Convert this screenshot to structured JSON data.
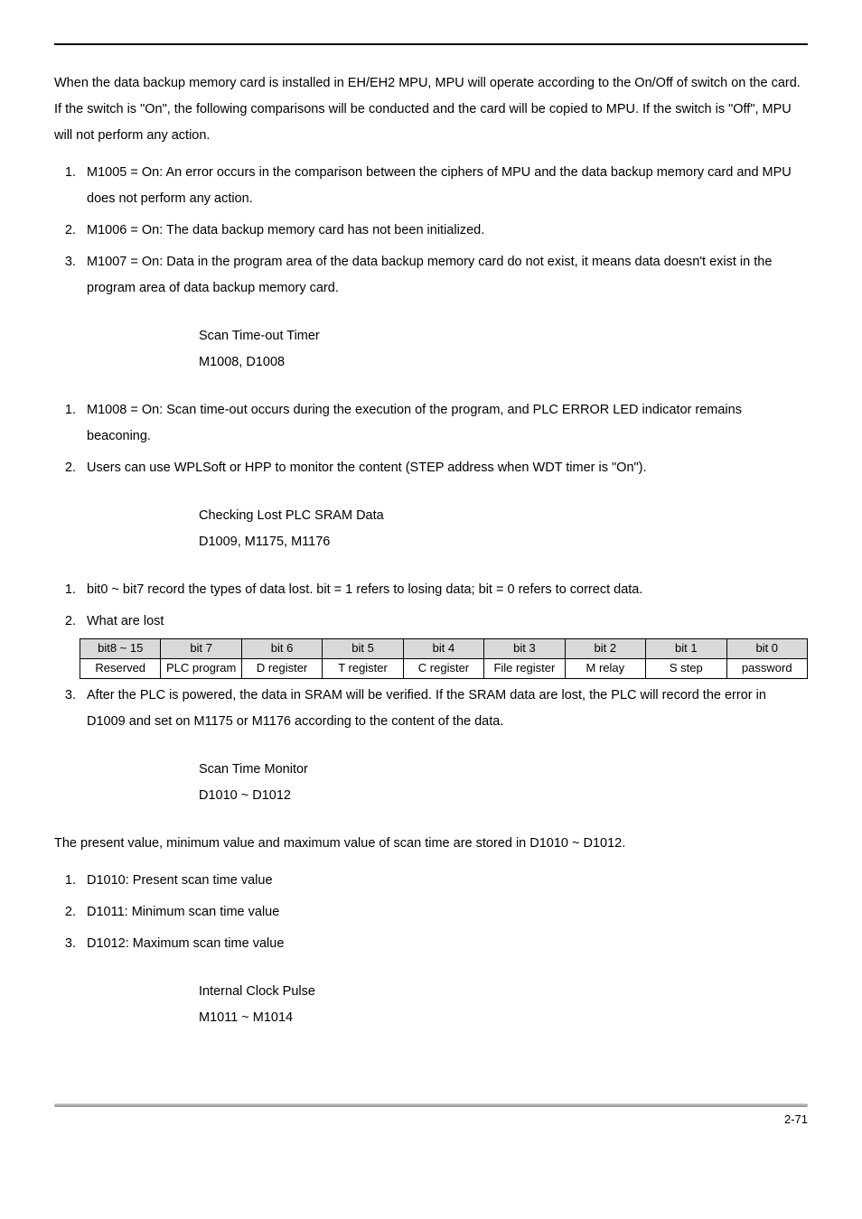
{
  "intro": "When the data backup memory card is installed in EH/EH2 MPU, MPU will operate according to the On/Off of switch on the card. If the switch is \"On\", the following comparisons will be conducted and the card will be copied to MPU. If the switch is \"Off\", MPU will not perform any action.",
  "introList": [
    "M1005 = On: An error occurs in the comparison between the ciphers of MPU and the data backup memory card and MPU does not perform any action.",
    "M1006 = On: The data backup memory card has not been initialized.",
    "M1007 = On: Data in the program area of the data backup memory card do not exist, it means data doesn't exist in the program area of data backup memory card."
  ],
  "sec1": {
    "title": "Scan Time-out Timer",
    "code": "M1008, D1008",
    "list": [
      "M1008 = On: Scan time-out occurs during the execution of the program, and PLC ERROR LED indicator remains beaconing.",
      "Users can use WPLSoft or HPP to monitor the content (STEP address when WDT timer is \"On\")."
    ]
  },
  "sec2": {
    "title": "Checking Lost PLC SRAM Data",
    "code": "D1009, M1175, M1176",
    "item1": "bit0 ~ bit7 record the types of data lost. bit = 1 refers to losing data; bit = 0 refers to correct data.",
    "item2": "What are lost",
    "item3": "After the PLC is powered, the data in SRAM will be verified. If the SRAM data are lost, the PLC will record the error in D1009 and set on M1175 or M1176 according to the content of the data."
  },
  "table": {
    "headers": [
      "bit8 ~ 15",
      "bit 7",
      "bit 6",
      "bit 5",
      "bit 4",
      "bit 3",
      "bit 2",
      "bit 1",
      "bit 0"
    ],
    "row": [
      "Reserved",
      "PLC program",
      "D register",
      "T register",
      "C register",
      "File register",
      "M relay",
      "S step",
      "password"
    ]
  },
  "sec3": {
    "title": "Scan Time Monitor",
    "code": "D1010 ~ D1012",
    "lead": "The present value, minimum value and maximum value of scan time are stored in D1010 ~ D1012.",
    "list": [
      "D1010: Present scan time value",
      "D1011: Minimum scan time value",
      "D1012: Maximum scan time value"
    ]
  },
  "sec4": {
    "title": "Internal Clock Pulse",
    "code": "M1011 ~ M1014"
  },
  "pageNumber": "2-71"
}
